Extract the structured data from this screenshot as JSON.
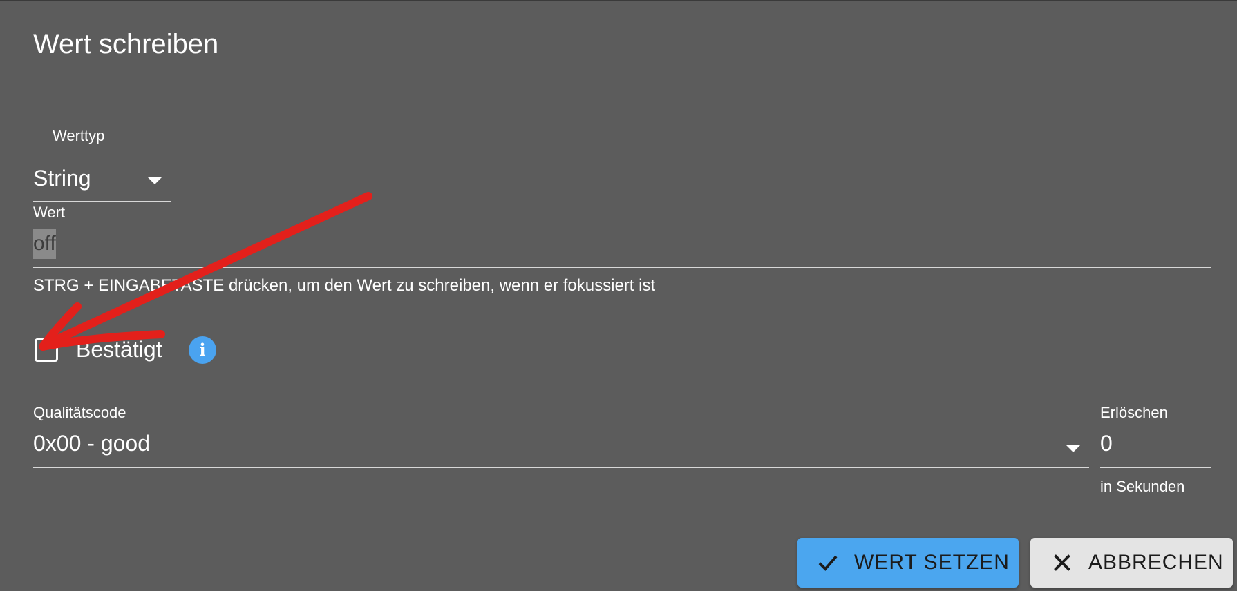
{
  "dialog": {
    "title": "Wert schreiben"
  },
  "value_type": {
    "label": "Werttyp",
    "selected": "String"
  },
  "value": {
    "label": "Wert",
    "current": "off",
    "hint": "STRG + EINGABETASTE drücken, um den Wert zu schreiben, wenn er fokussiert ist"
  },
  "ack": {
    "label": "Bestätigt",
    "checked": false,
    "info_icon": "info-icon"
  },
  "quality": {
    "label": "Qualitätscode",
    "selected": "0x00 - good"
  },
  "expire": {
    "label": "Erlöschen",
    "value": "0",
    "helper": "in Sekunden"
  },
  "buttons": {
    "set_label": "WERT SETZEN",
    "cancel_label": "ABBRECHEN"
  },
  "colors": {
    "background": "#5c5c5c",
    "primary": "#4ba6ef",
    "annotation_arrow": "#e3201b"
  }
}
